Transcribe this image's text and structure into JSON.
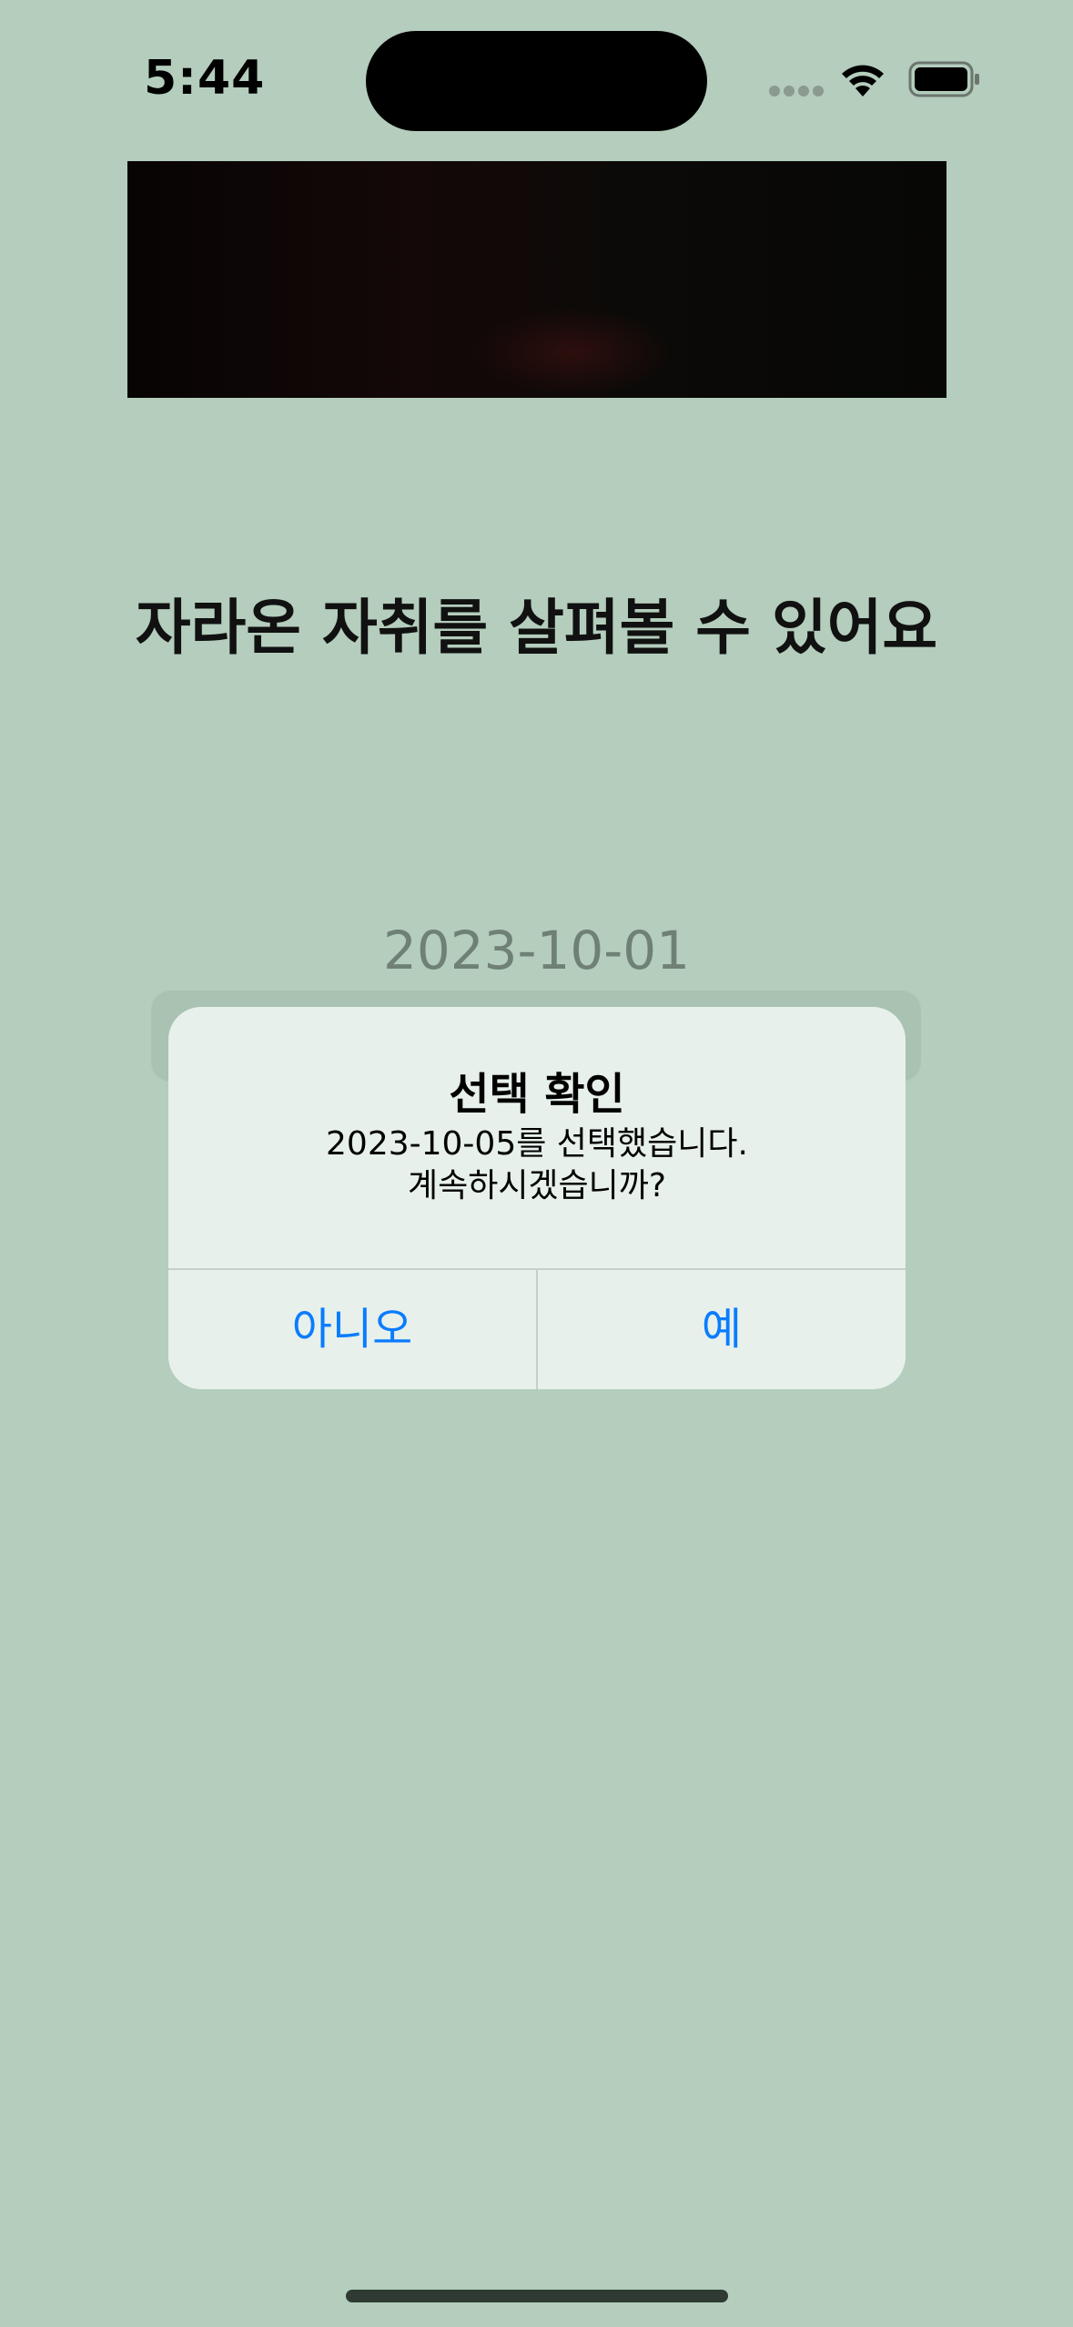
{
  "status_bar": {
    "time": "5:44",
    "icons": [
      "signal-dots-icon",
      "wifi-icon",
      "battery-icon"
    ]
  },
  "main": {
    "headline": "자라온 자취를 살펴볼 수 있어요",
    "selected_date": "2023-10-01"
  },
  "alert": {
    "title": "선택 확인",
    "message_line1": "2023-10-05를 선택했습니다.",
    "message_line2": "계속하시겠습니까?",
    "cancel_label": "아니오",
    "confirm_label": "예"
  },
  "colors": {
    "background": "#b4cdbc",
    "alert_background": "#e7f0ea",
    "button_text": "#0a7cff"
  }
}
